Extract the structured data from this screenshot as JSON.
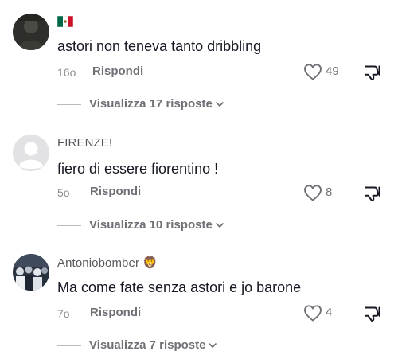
{
  "comments": [
    {
      "username": "",
      "flag_icon": "mexico-flag-icon",
      "text": "astori non teneva tanto dribbling",
      "time": "16o",
      "reply_label": "Rispondi",
      "likes": "49",
      "replies_label": "Visualizza 17 risposte"
    },
    {
      "username": "FIRENZE!",
      "text": "fiero di essere fiorentino !",
      "time": "5o",
      "reply_label": "Rispondi",
      "likes": "8",
      "replies_label": "Visualizza 10 risposte"
    },
    {
      "username": "Antoniobomber",
      "username_emoji": "🦁",
      "text": "Ma come fate senza astori e jo barone",
      "time": "7o",
      "reply_label": "Rispondi",
      "likes": "4",
      "replies_label": "Visualizza 7 risposte"
    }
  ],
  "colors": {
    "text_primary": "#161823",
    "text_secondary": "#6f7076",
    "username": "#57585e"
  }
}
